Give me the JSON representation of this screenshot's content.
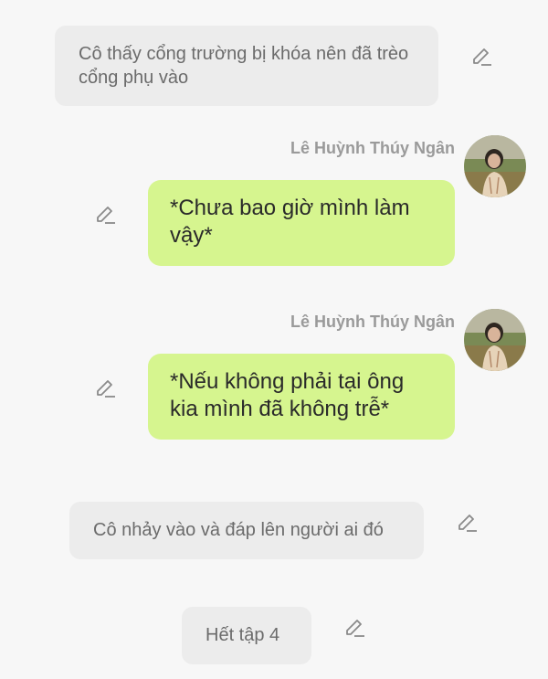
{
  "messages": [
    {
      "type": "narration",
      "text": "Cô thấy cổng trường bị khóa nên đã trèo cổng phụ vào"
    },
    {
      "type": "character",
      "sender": "Lê Huỳnh Thúy Ngân",
      "text": "*Chưa bao giờ mình làm vậy*",
      "avatar_icon": "avatar-photo"
    },
    {
      "type": "character",
      "sender": "Lê Huỳnh Thúy Ngân",
      "text": "*Nếu không phải tại ông kia mình đã không trễ*",
      "avatar_icon": "avatar-photo"
    },
    {
      "type": "narration",
      "text": "Cô nhảy vào và đáp lên người ai đó"
    },
    {
      "type": "narration",
      "text": "Hết tập 4"
    }
  ],
  "icons": {
    "edit": "pencil-edit-icon"
  },
  "colors": {
    "background": "#f7f7f7",
    "narration_bubble": "#ececec",
    "character_bubble": "#d6f58f",
    "sender_text": "#9a9a9a"
  }
}
